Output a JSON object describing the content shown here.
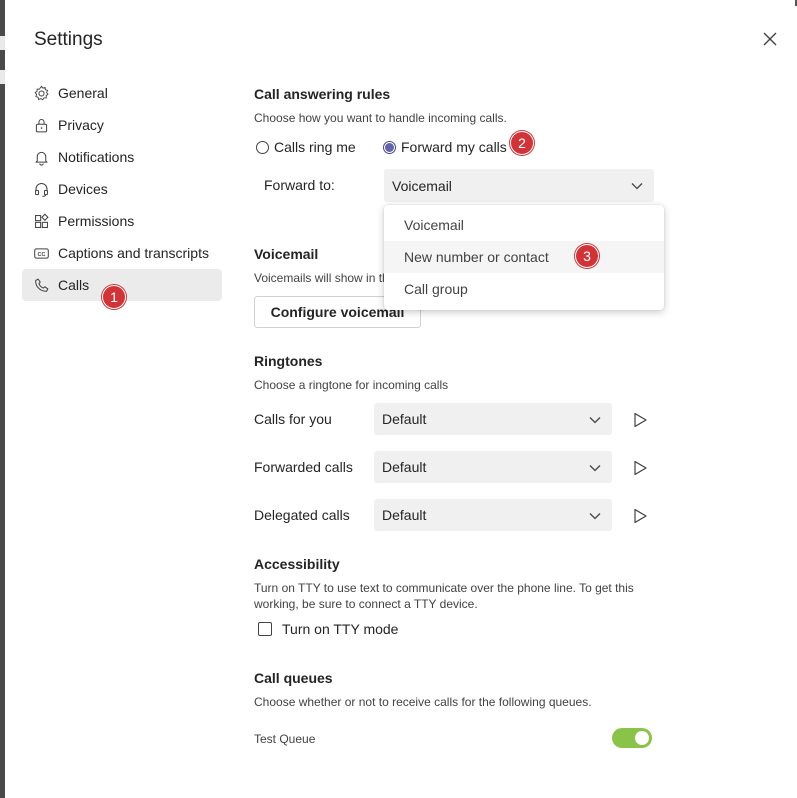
{
  "window": {
    "title": "Settings"
  },
  "sidebar": {
    "items": [
      {
        "label": "General",
        "icon": "gear-icon"
      },
      {
        "label": "Privacy",
        "icon": "lock-icon"
      },
      {
        "label": "Notifications",
        "icon": "bell-icon"
      },
      {
        "label": "Devices",
        "icon": "headset-icon"
      },
      {
        "label": "Permissions",
        "icon": "apps-icon"
      },
      {
        "label": "Captions and transcripts",
        "icon": "cc-icon"
      },
      {
        "label": "Calls",
        "icon": "phone-icon",
        "selected": true
      }
    ]
  },
  "badges": {
    "one": "1",
    "two": "2",
    "three": "3",
    "color": "#d13438"
  },
  "call_answering": {
    "heading": "Call answering rules",
    "description": "Choose how you want to handle incoming calls.",
    "option_ring": "Calls ring me",
    "option_forward": "Forward my calls",
    "selected": "Forward my calls",
    "forward_to_label": "Forward to:",
    "forward_to_value": "Voicemail",
    "dropdown_options": [
      "Voicemail",
      "New number or contact",
      "Call group"
    ]
  },
  "voicemail": {
    "heading": "Voicemail",
    "description": "Voicemails will show in th",
    "button": "Configure voicemail"
  },
  "ringtones": {
    "heading": "Ringtones",
    "description": "Choose a ringtone for incoming calls",
    "rows": [
      {
        "label": "Calls for you",
        "value": "Default"
      },
      {
        "label": "Forwarded calls",
        "value": "Default"
      },
      {
        "label": "Delegated calls",
        "value": "Default"
      }
    ]
  },
  "accessibility": {
    "heading": "Accessibility",
    "description_line1": "Turn on TTY to use text to communicate over the phone line. To get this",
    "description_line2": "working, be sure to connect a TTY device.",
    "checkbox_label": "Turn on TTY mode",
    "checked": false
  },
  "call_queues": {
    "heading": "Call queues",
    "description": "Choose whether or not to receive calls for the following queues.",
    "queue_name": "Test Queue",
    "enabled": true
  },
  "colors": {
    "accent": "#6264a7",
    "toggle_on": "#8bc34a",
    "badge": "#d13438"
  }
}
